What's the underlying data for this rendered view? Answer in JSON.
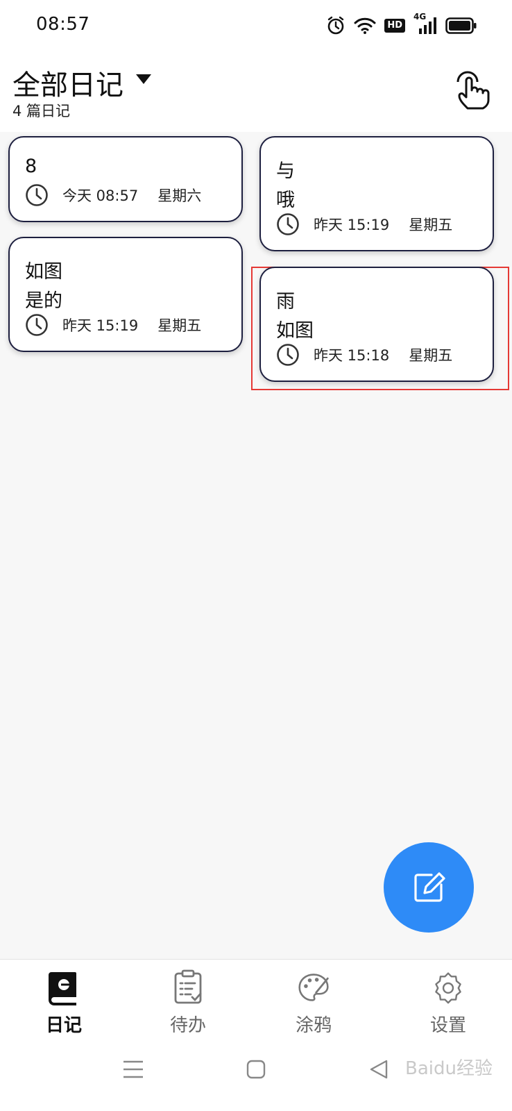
{
  "status_bar": {
    "time": "08:57",
    "icons": [
      "alarm-icon",
      "wifi-icon",
      "hd-icon",
      "signal-4g-icon",
      "battery-icon"
    ],
    "hd_label": "HD",
    "network_label": "4G"
  },
  "header": {
    "title": "全部日记",
    "subtitle": "4 篇日记"
  },
  "cards": [
    {
      "lines": [
        "8"
      ],
      "day": "今天 08:57",
      "weekday": "星期六"
    },
    {
      "lines": [
        "与",
        "哦"
      ],
      "day": "昨天 15:19",
      "weekday": "星期五"
    },
    {
      "lines": [
        "如图",
        "是的"
      ],
      "day": "昨天 15:19",
      "weekday": "星期五"
    },
    {
      "lines": [
        "雨",
        "如图"
      ],
      "day": "昨天 15:18",
      "weekday": "星期五"
    }
  ],
  "bottom_nav": [
    {
      "label": "日记",
      "icon": "diary-book-icon",
      "active": true
    },
    {
      "label": "待办",
      "icon": "clipboard-check-icon",
      "active": false
    },
    {
      "label": "涂鸦",
      "icon": "palette-icon",
      "active": false
    },
    {
      "label": "设置",
      "icon": "gear-icon",
      "active": false
    }
  ],
  "watermark": "Baidu经验",
  "colors": {
    "accent": "#2e8bf7",
    "card_border": "#1d1f3f",
    "selection": "#e53935",
    "background": "#f7f7f7"
  }
}
